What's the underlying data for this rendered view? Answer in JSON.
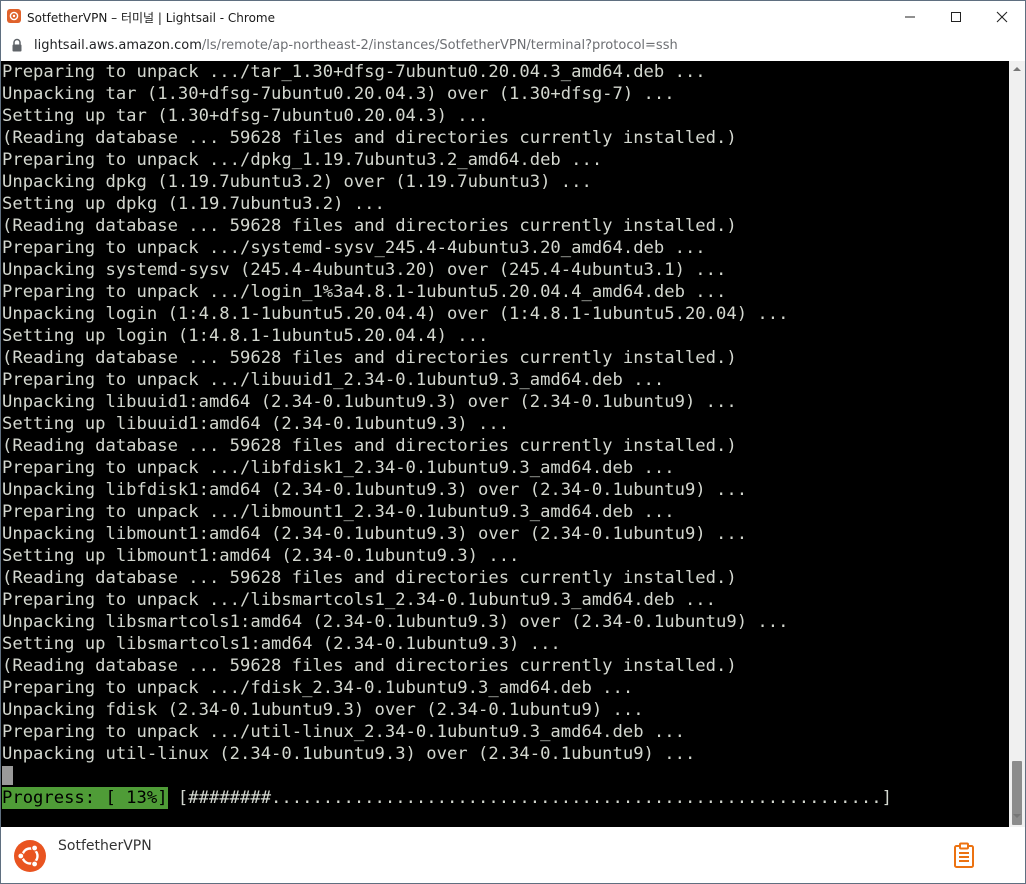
{
  "window": {
    "title": "SotfetherVPN – 터미널 | Lightsail - Chrome"
  },
  "address": {
    "host": "lightsail.aws.amazon.com",
    "path": "/ls/remote/ap-northeast-2/instances/SotfetherVPN/terminal?protocol=ssh"
  },
  "terminal": {
    "lines": [
      "Preparing to unpack .../tar_1.30+dfsg-7ubuntu0.20.04.3_amd64.deb ...",
      "Unpacking tar (1.30+dfsg-7ubuntu0.20.04.3) over (1.30+dfsg-7) ...",
      "Setting up tar (1.30+dfsg-7ubuntu0.20.04.3) ...",
      "(Reading database ... 59628 files and directories currently installed.)",
      "Preparing to unpack .../dpkg_1.19.7ubuntu3.2_amd64.deb ...",
      "Unpacking dpkg (1.19.7ubuntu3.2) over (1.19.7ubuntu3) ...",
      "Setting up dpkg (1.19.7ubuntu3.2) ...",
      "(Reading database ... 59628 files and directories currently installed.)",
      "Preparing to unpack .../systemd-sysv_245.4-4ubuntu3.20_amd64.deb ...",
      "Unpacking systemd-sysv (245.4-4ubuntu3.20) over (245.4-4ubuntu3.1) ...",
      "Preparing to unpack .../login_1%3a4.8.1-1ubuntu5.20.04.4_amd64.deb ...",
      "Unpacking login (1:4.8.1-1ubuntu5.20.04.4) over (1:4.8.1-1ubuntu5.20.04) ...",
      "Setting up login (1:4.8.1-1ubuntu5.20.04.4) ...",
      "(Reading database ... 59628 files and directories currently installed.)",
      "Preparing to unpack .../libuuid1_2.34-0.1ubuntu9.3_amd64.deb ...",
      "Unpacking libuuid1:amd64 (2.34-0.1ubuntu9.3) over (2.34-0.1ubuntu9) ...",
      "Setting up libuuid1:amd64 (2.34-0.1ubuntu9.3) ...",
      "(Reading database ... 59628 files and directories currently installed.)",
      "Preparing to unpack .../libfdisk1_2.34-0.1ubuntu9.3_amd64.deb ...",
      "Unpacking libfdisk1:amd64 (2.34-0.1ubuntu9.3) over (2.34-0.1ubuntu9) ...",
      "Preparing to unpack .../libmount1_2.34-0.1ubuntu9.3_amd64.deb ...",
      "Unpacking libmount1:amd64 (2.34-0.1ubuntu9.3) over (2.34-0.1ubuntu9) ...",
      "Setting up libmount1:amd64 (2.34-0.1ubuntu9.3) ...",
      "(Reading database ... 59628 files and directories currently installed.)",
      "Preparing to unpack .../libsmartcols1_2.34-0.1ubuntu9.3_amd64.deb ...",
      "Unpacking libsmartcols1:amd64 (2.34-0.1ubuntu9.3) over (2.34-0.1ubuntu9) ...",
      "Setting up libsmartcols1:amd64 (2.34-0.1ubuntu9.3) ...",
      "(Reading database ... 59628 files and directories currently installed.)",
      "Preparing to unpack .../fdisk_2.34-0.1ubuntu9.3_amd64.deb ...",
      "Unpacking fdisk (2.34-0.1ubuntu9.3) over (2.34-0.1ubuntu9) ...",
      "Preparing to unpack .../util-linux_2.34-0.1ubuntu9.3_amd64.deb ...",
      "Unpacking util-linux (2.34-0.1ubuntu9.3) over (2.34-0.1ubuntu9) ..."
    ],
    "progress_label": "Progress: [ 13%]",
    "progress_bar": " [########...........................................................]"
  },
  "footer": {
    "instance_name": "SotfetherVPN"
  },
  "colors": {
    "terminal_bg": "#000000",
    "terminal_fg": "#d3d7cf",
    "progress_bg": "#4f9c37",
    "ubuntu_orange": "#e95420",
    "clipboard_orange": "#ec7211"
  }
}
